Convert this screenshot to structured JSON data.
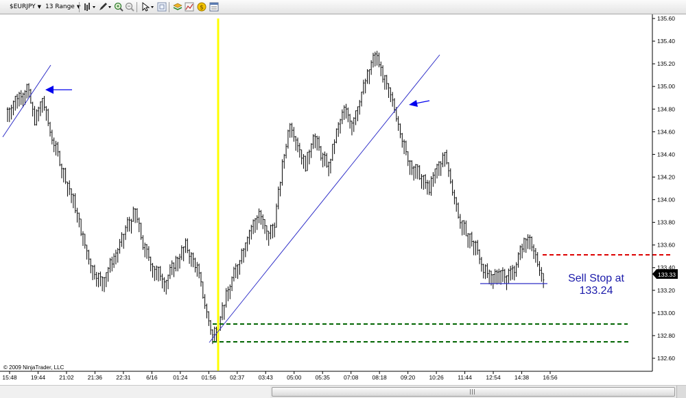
{
  "toolbar": {
    "instrument": "$EURJPY",
    "period": "13 Range"
  },
  "price_axis": {
    "ticks": [
      "135.60",
      "135.40",
      "135.20",
      "135.00",
      "134.80",
      "134.60",
      "134.40",
      "134.20",
      "134.00",
      "133.80",
      "133.60",
      "133.40",
      "133.20",
      "133.00",
      "132.80",
      "132.60"
    ],
    "current_price": "133.33"
  },
  "time_axis": {
    "ticks": [
      "15:48",
      "19:44",
      "21:02",
      "21:36",
      "22:31",
      "6/16",
      "01:24",
      "01:56",
      "02:37",
      "03:43",
      "05:00",
      "05:35",
      "07:08",
      "08:18",
      "09:20",
      "10:26",
      "11:44",
      "12:54",
      "14:38",
      "16:56"
    ]
  },
  "annotation": {
    "line1": "Sell Stop at",
    "line2": "133.24"
  },
  "copyright": "© 2009 NinjaTrader, LLC",
  "colors": {
    "bars": "#000000",
    "trendline": "#2e2ec8",
    "arrow": "#0000ee",
    "vertical_marker": "#ffff00",
    "sell_stop_line": "#dd0000",
    "stop_lines": "#006400",
    "annotation_text": "#1a1aaa",
    "price_box": "#000000"
  },
  "chart_data": {
    "type": "ohlc",
    "instrument": "$EURJPY",
    "bar_type": "13 Range",
    "ylim": [
      132.6,
      135.6
    ],
    "current_price": 133.33,
    "levels": [
      {
        "price": 133.5,
        "style": "dashed",
        "color": "#dd0000"
      },
      {
        "price": 132.88,
        "style": "dashed",
        "color": "#006400"
      },
      {
        "price": 132.73,
        "style": "dashed",
        "color": "#006400"
      },
      {
        "price": 133.24,
        "style": "solid",
        "color": "#2e2ec8"
      }
    ],
    "close_path": [
      [
        0,
        134.8
      ],
      [
        4,
        134.9
      ],
      [
        10,
        135.0
      ],
      [
        14,
        134.7
      ],
      [
        18,
        134.9
      ],
      [
        22,
        134.6
      ],
      [
        28,
        134.3
      ],
      [
        34,
        134.0
      ],
      [
        40,
        133.6
      ],
      [
        44,
        133.4
      ],
      [
        48,
        133.3
      ],
      [
        52,
        133.4
      ],
      [
        58,
        133.6
      ],
      [
        62,
        133.8
      ],
      [
        66,
        133.9
      ],
      [
        70,
        133.6
      ],
      [
        76,
        133.4
      ],
      [
        82,
        133.3
      ],
      [
        88,
        133.5
      ],
      [
        92,
        133.6
      ],
      [
        98,
        133.4
      ],
      [
        103,
        133.0
      ],
      [
        106,
        132.8
      ],
      [
        112,
        133.1
      ],
      [
        118,
        133.4
      ],
      [
        124,
        133.7
      ],
      [
        130,
        133.9
      ],
      [
        134,
        133.7
      ],
      [
        138,
        133.8
      ],
      [
        142,
        134.3
      ],
      [
        146,
        134.7
      ],
      [
        150,
        134.5
      ],
      [
        154,
        134.3
      ],
      [
        158,
        134.6
      ],
      [
        162,
        134.4
      ],
      [
        166,
        134.3
      ],
      [
        170,
        134.6
      ],
      [
        174,
        134.8
      ],
      [
        178,
        134.7
      ],
      [
        182,
        134.9
      ],
      [
        186,
        135.1
      ],
      [
        190,
        135.3
      ],
      [
        194,
        135.1
      ],
      [
        198,
        134.9
      ],
      [
        202,
        134.7
      ],
      [
        206,
        134.4
      ],
      [
        210,
        134.3
      ],
      [
        214,
        134.2
      ],
      [
        218,
        134.1
      ],
      [
        222,
        134.3
      ],
      [
        226,
        134.4
      ],
      [
        230,
        134.1
      ],
      [
        234,
        133.8
      ],
      [
        238,
        133.7
      ],
      [
        242,
        133.6
      ],
      [
        246,
        133.4
      ],
      [
        250,
        133.3
      ],
      [
        254,
        133.4
      ],
      [
        258,
        133.35
      ],
      [
        262,
        133.4
      ],
      [
        266,
        133.6
      ],
      [
        270,
        133.7
      ],
      [
        274,
        133.4
      ],
      [
        277,
        133.33
      ]
    ]
  }
}
